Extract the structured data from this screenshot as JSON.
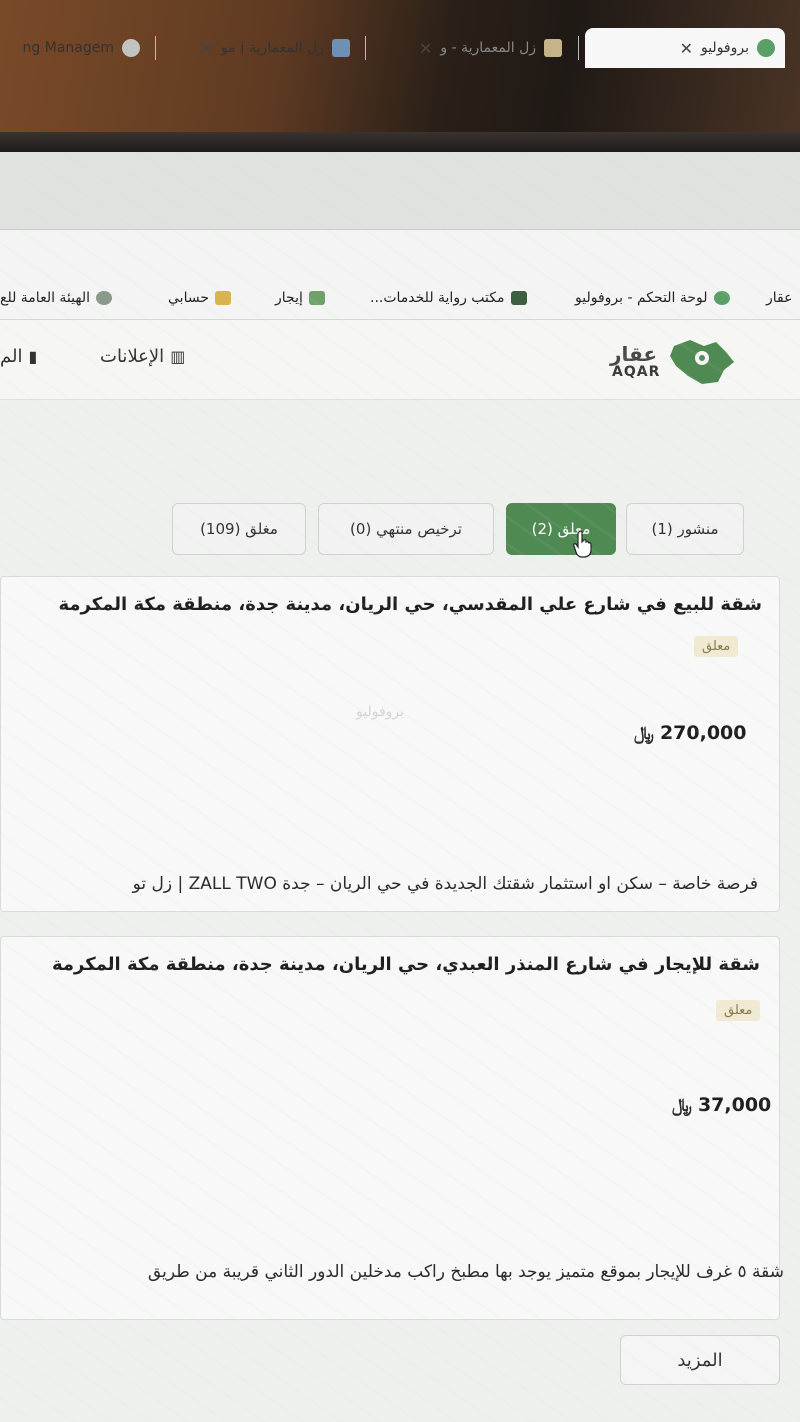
{
  "browser": {
    "tabs": [
      {
        "label": "ng Managem",
        "icon": "page-icon"
      },
      {
        "label": "زل المعمارية | مو",
        "icon": "site-icon"
      },
      {
        "label": "زل المعمارية - و",
        "icon": "site-icon"
      },
      {
        "label": "بروفوليو",
        "icon": "profolio-icon"
      }
    ],
    "bookmarks": [
      {
        "label": "لوحة التحكم - بروفوليو"
      },
      {
        "label": "مكتب رواية للخدمات..."
      },
      {
        "label": "إيجار"
      },
      {
        "label": "حسابي"
      },
      {
        "label": "الهيئة العامة للع"
      },
      {
        "label": "عقار"
      }
    ]
  },
  "site": {
    "logo_ar": "عقار",
    "logo_en": "AQAR",
    "nav": [
      {
        "label": "الإعلانات"
      },
      {
        "label": "الم"
      }
    ]
  },
  "filters": [
    {
      "label": "منشور (1)",
      "active": false
    },
    {
      "label": "معلق (2)",
      "active": true
    },
    {
      "label": "ترخيص منتهي (0)",
      "active": false
    },
    {
      "label": "مغلق (109)",
      "active": false
    }
  ],
  "listings": [
    {
      "title": "شقة للبيع في شارع علي المقدسي، حي الريان، مدينة جدة، منطقة مكة المكرمة",
      "status": "معلق",
      "price": "270,000",
      "currency": "ريال",
      "project": "فرصة خاصة – سكن او استثمار شقتك الجديدة في حي الريان – جدة ZALL TWO | زل تو"
    },
    {
      "title": "شقة للإيجار في شارع المنذر العبدي، حي الريان، مدينة جدة، منطقة مكة المكرمة",
      "status": "معلق",
      "price": "37,000",
      "currency": "ريال",
      "project": "شقة ٥ غرف للإيجار بموقع متميز يوجد بها مطبخ راكب مدخلين الدور الثاني قريبة من طريق"
    }
  ],
  "watermark": "بروفوليو",
  "more_button": "المزيد",
  "colors": {
    "accent_green": "#4f8a52",
    "badge_bg": "#f0ead3"
  }
}
